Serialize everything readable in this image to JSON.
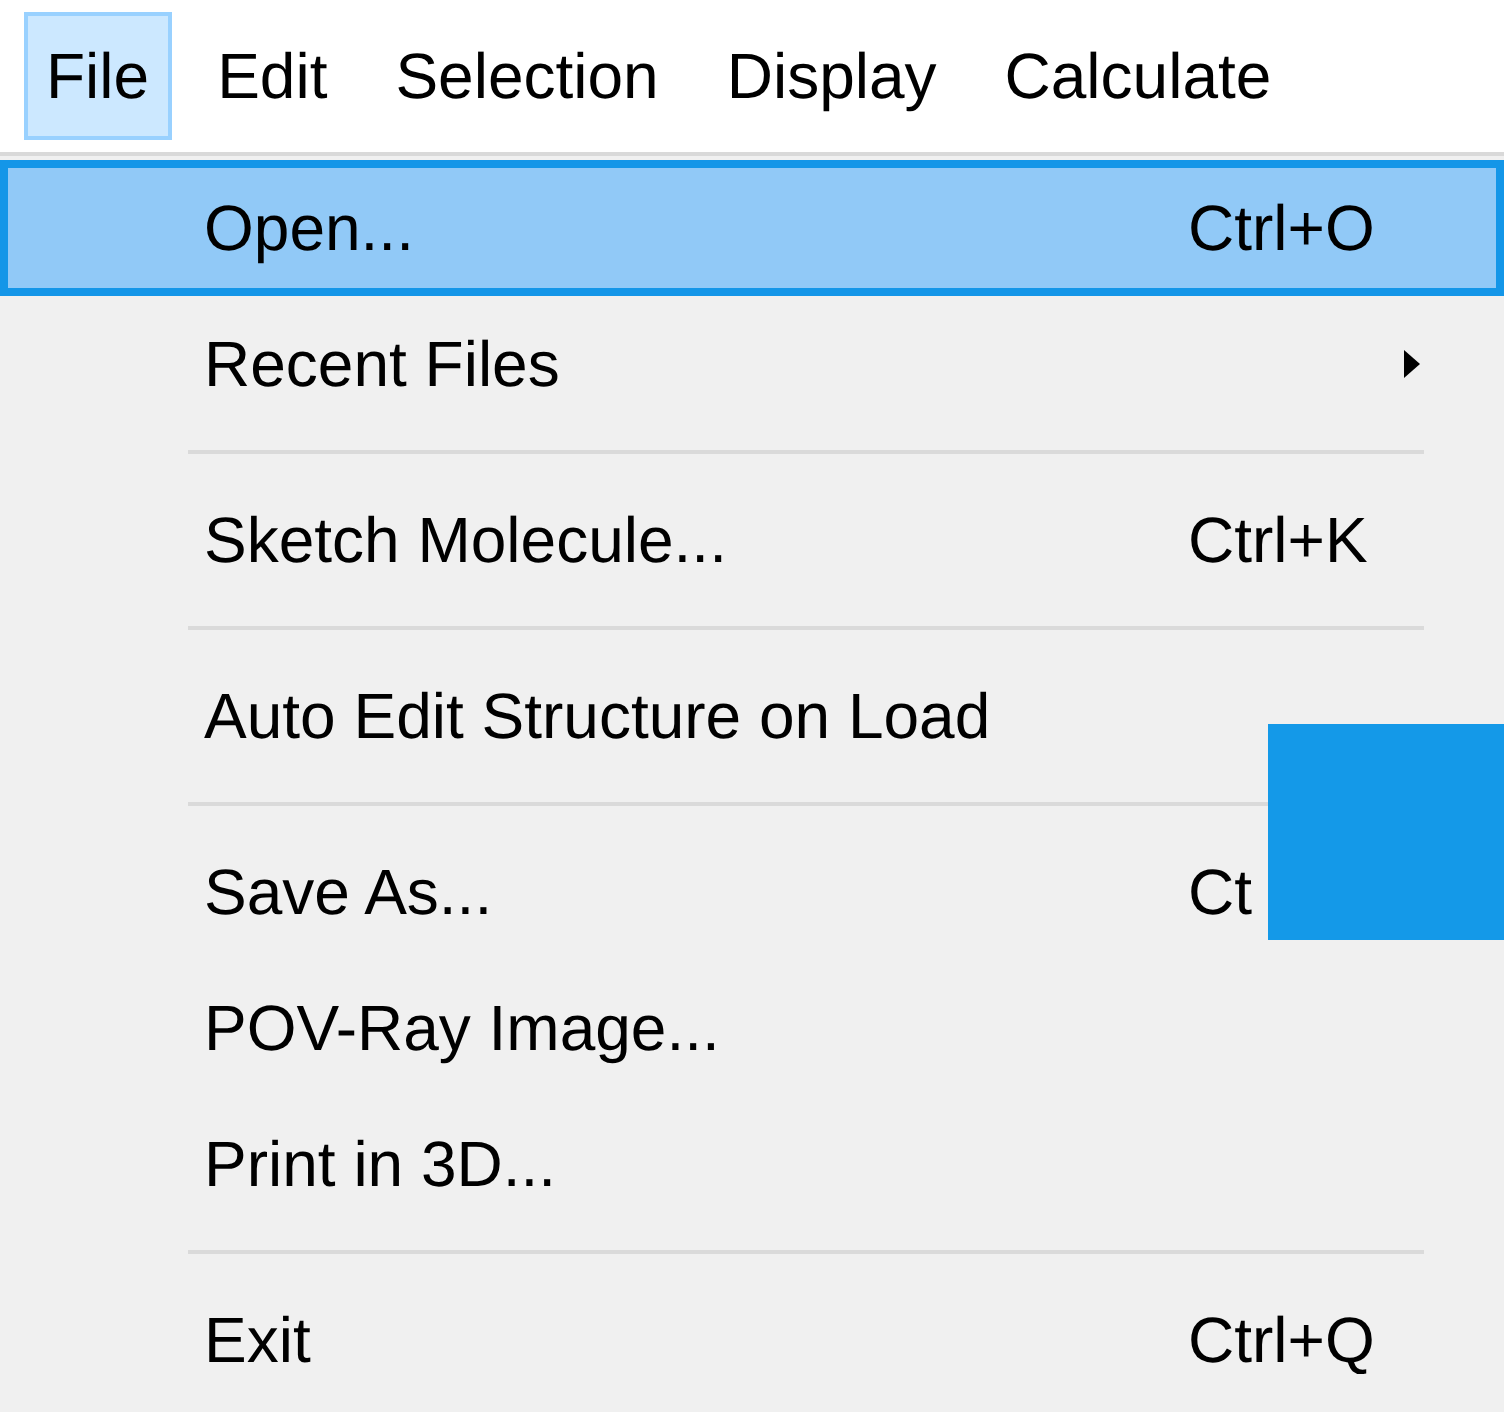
{
  "menubar": [
    {
      "label": "File",
      "selected": true
    },
    {
      "label": "Edit",
      "selected": false
    },
    {
      "label": "Selection",
      "selected": false
    },
    {
      "label": "Display",
      "selected": false
    },
    {
      "label": "Calculate",
      "selected": false
    }
  ],
  "menu": {
    "items": [
      {
        "kind": "item",
        "label": "Open...",
        "shortcut": "Ctrl+O",
        "selected": true
      },
      {
        "kind": "submenu",
        "label": "Recent Files",
        "selected": false
      },
      {
        "kind": "separator"
      },
      {
        "kind": "item",
        "label": "Sketch Molecule...",
        "shortcut": "Ctrl+K",
        "selected": false
      },
      {
        "kind": "separator"
      },
      {
        "kind": "item",
        "label": "Auto Edit Structure on Load",
        "selected": false
      },
      {
        "kind": "separator"
      },
      {
        "kind": "item",
        "label": "Save As...",
        "shortcut": "Ct",
        "selected": false
      },
      {
        "kind": "item",
        "label": "POV-Ray Image...",
        "selected": false
      },
      {
        "kind": "item",
        "label": "Print in 3D...",
        "selected": false
      },
      {
        "kind": "separator"
      },
      {
        "kind": "item",
        "label": "Exit",
        "shortcut": "Ctrl+Q",
        "selected": false
      }
    ]
  }
}
